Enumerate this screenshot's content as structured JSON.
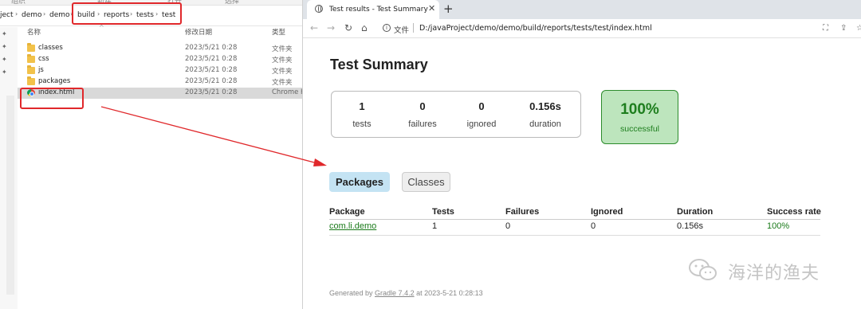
{
  "explorer": {
    "ribbon": [
      "组织",
      "新建",
      "打开",
      "选择"
    ],
    "breadcrumb": [
      "ject",
      "demo",
      "demo",
      "build",
      "reports",
      "tests",
      "test"
    ],
    "columns": {
      "name": "名称",
      "date": "修改日期",
      "type": "类型"
    },
    "files": [
      {
        "name": "classes",
        "date": "2023/5/21 0:28",
        "type": "文件夹",
        "icon": "folder-icon"
      },
      {
        "name": "css",
        "date": "2023/5/21 0:28",
        "type": "文件夹",
        "icon": "folder-icon"
      },
      {
        "name": "js",
        "date": "2023/5/21 0:28",
        "type": "文件夹",
        "icon": "folder-icon"
      },
      {
        "name": "packages",
        "date": "2023/5/21 0:28",
        "type": "文件夹",
        "icon": "folder-icon"
      },
      {
        "name": "index.html",
        "date": "2023/5/21 0:28",
        "type": "Chrome H",
        "icon": "chrome-icon",
        "selected": true
      }
    ]
  },
  "browser": {
    "tab_title": "Test results - Test Summary",
    "file_label": "文件",
    "url": "D:/javaProject/demo/demo/build/reports/tests/test/index.html",
    "page": {
      "title": "Test Summary",
      "stats": [
        {
          "value": "1",
          "label": "tests"
        },
        {
          "value": "0",
          "label": "failures"
        },
        {
          "value": "0",
          "label": "ignored"
        },
        {
          "value": "0.156s",
          "label": "duration"
        }
      ],
      "success": {
        "percent": "100%",
        "label": "successful"
      },
      "tabs": [
        "Packages",
        "Classes"
      ],
      "table": {
        "headers": [
          "Package",
          "Tests",
          "Failures",
          "Ignored",
          "Duration",
          "Success rate"
        ],
        "rows": [
          [
            "com.li.demo",
            "1",
            "0",
            "0",
            "0.156s",
            "100%"
          ]
        ]
      },
      "footer": {
        "prefix": "Generated by ",
        "link": "Gradle 7.4.2",
        "suffix": " at 2023-5-21 0:28:13"
      }
    }
  },
  "watermark": "海洋的渔夫",
  "colors": {
    "highlight": "#e0282b",
    "success": "#1e7e1e",
    "packages_tab": "#c4e3f3"
  }
}
